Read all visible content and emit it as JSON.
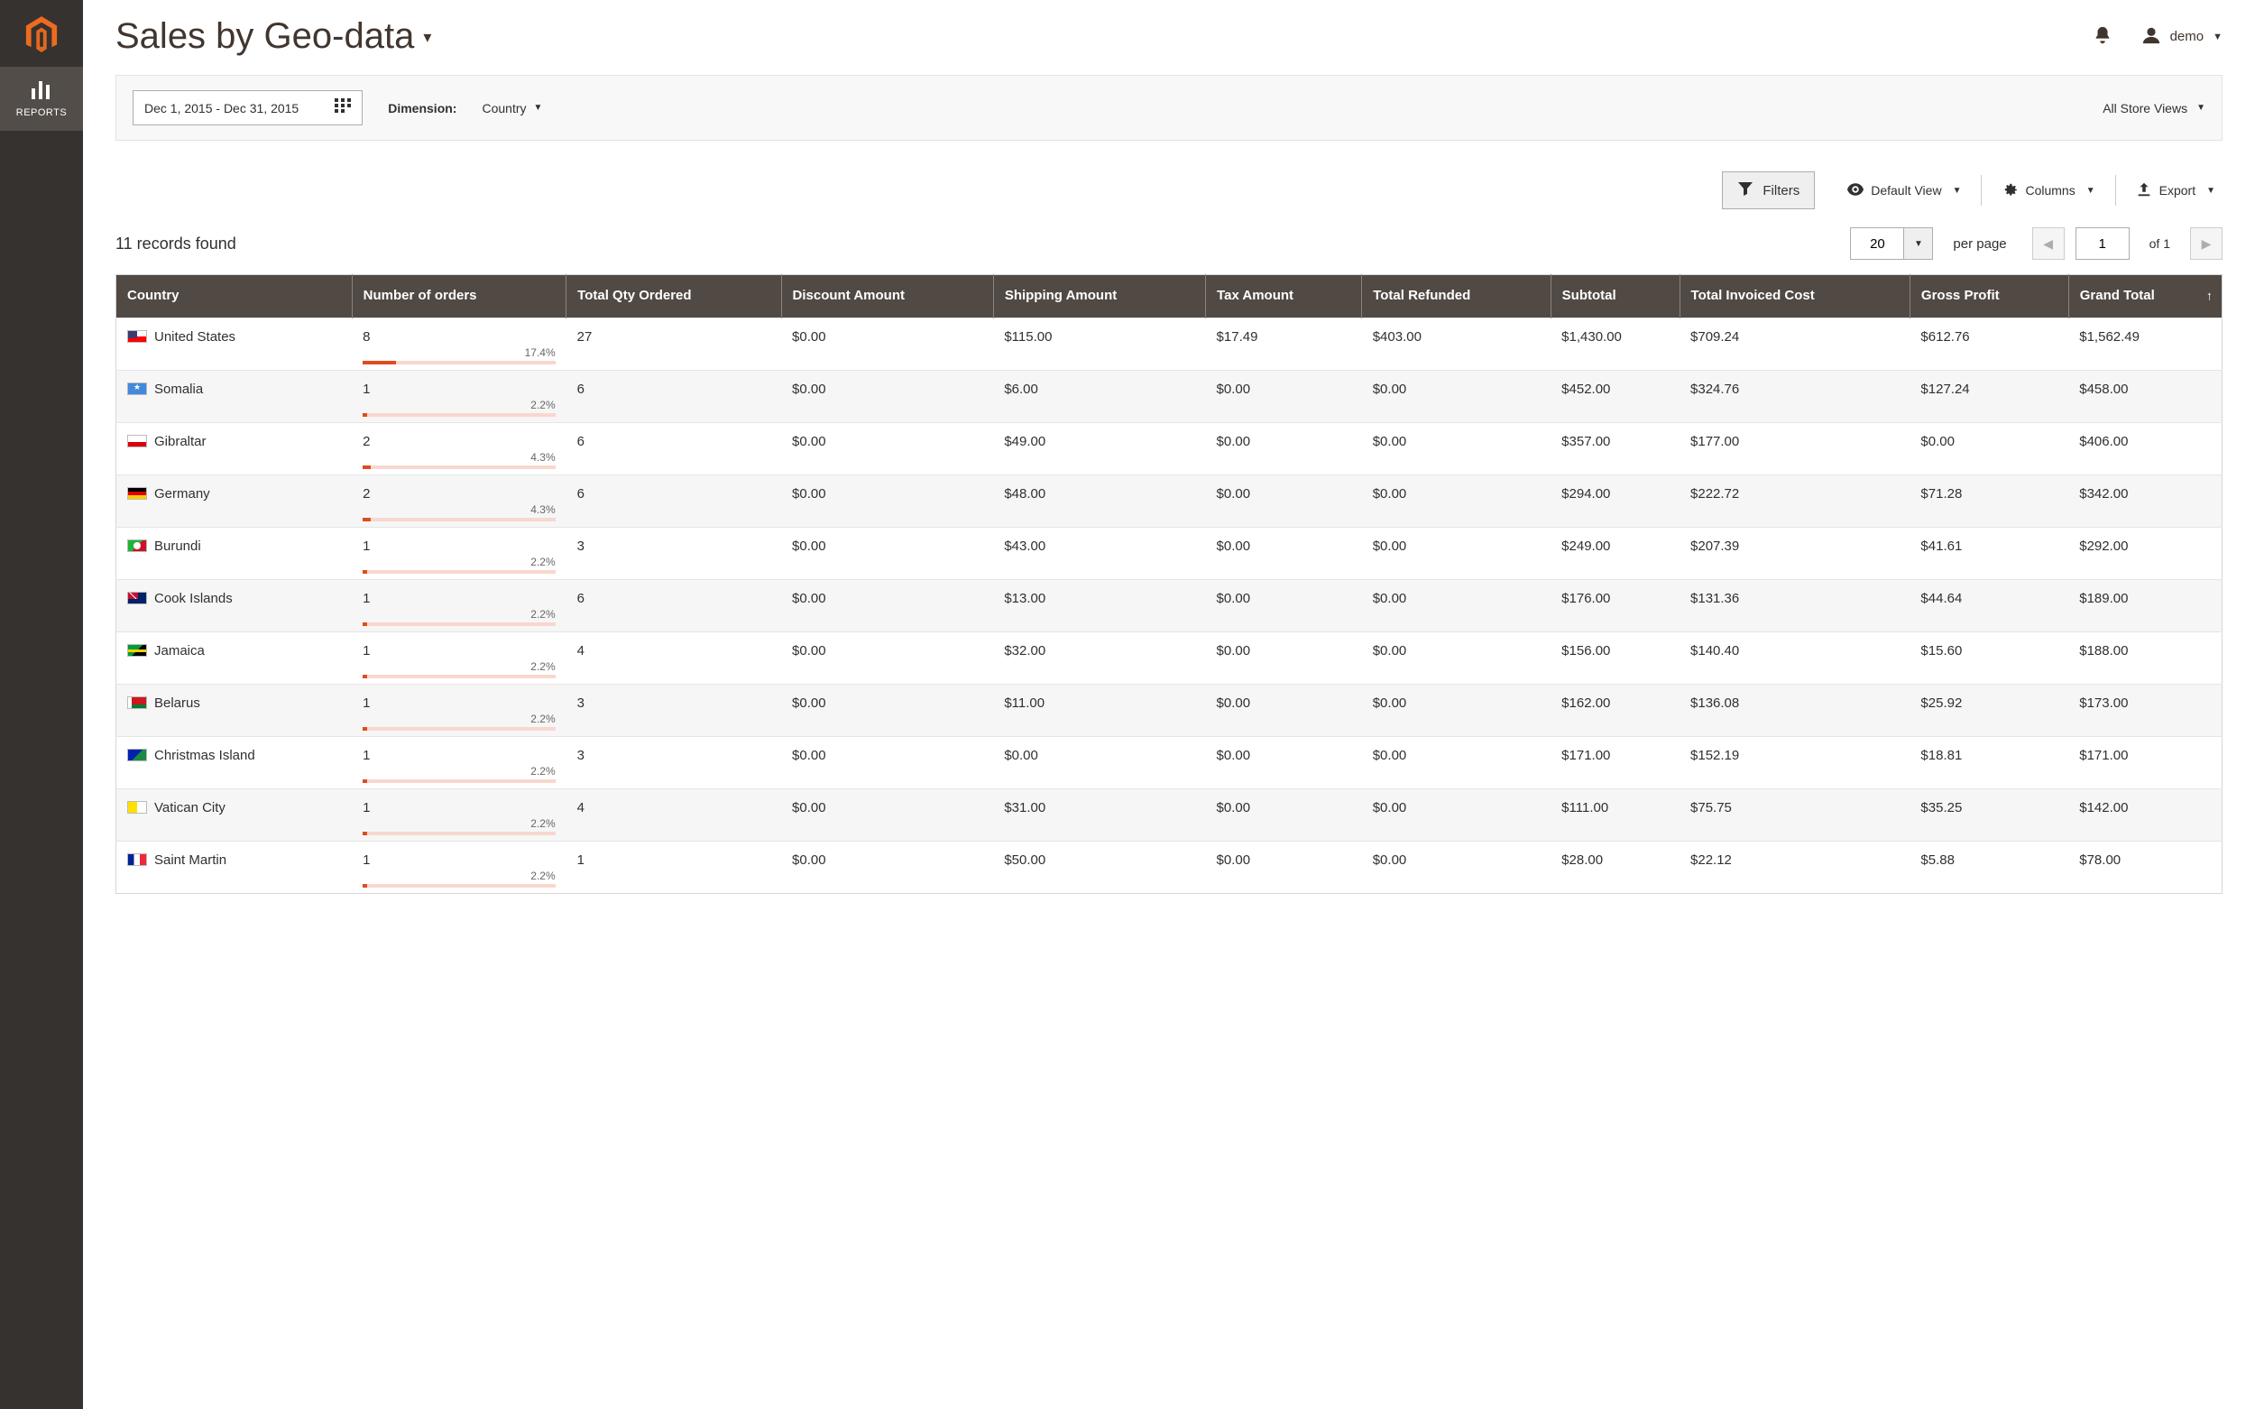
{
  "sidebar": {
    "reports_label": "REPORTS"
  },
  "header": {
    "title": "Sales by Geo-data",
    "user_name": "demo"
  },
  "toolbar": {
    "date_range": "Dec 1, 2015 - Dec 31, 2015",
    "dimension_label": "Dimension:",
    "dimension_value": "Country",
    "store_view": "All Store Views"
  },
  "actions": {
    "filters": "Filters",
    "default_view": "Default View",
    "columns": "Columns",
    "export": "Export"
  },
  "records": {
    "count_text": "11 records found",
    "per_page_value": "20",
    "per_page_label": "per page",
    "page_value": "1",
    "of_label": "of 1"
  },
  "columns": [
    "Country",
    "Number of orders",
    "Total Qty Ordered",
    "Discount Amount",
    "Shipping Amount",
    "Tax Amount",
    "Total Refunded",
    "Subtotal",
    "Total Invoiced Cost",
    "Gross Profit",
    "Grand Total"
  ],
  "rows": [
    {
      "flag": "us",
      "country": "United States",
      "orders": "8",
      "orders_pct": "17.4%",
      "bar_pct": 17.4,
      "qty": "27",
      "discount": "$0.00",
      "shipping": "$115.00",
      "tax": "$17.49",
      "refunded": "$403.00",
      "subtotal": "$1,430.00",
      "invoiced": "$709.24",
      "profit": "$612.76",
      "grand": "$1,562.49"
    },
    {
      "flag": "so",
      "country": "Somalia",
      "orders": "1",
      "orders_pct": "2.2%",
      "bar_pct": 2.2,
      "qty": "6",
      "discount": "$0.00",
      "shipping": "$6.00",
      "tax": "$0.00",
      "refunded": "$0.00",
      "subtotal": "$452.00",
      "invoiced": "$324.76",
      "profit": "$127.24",
      "grand": "$458.00"
    },
    {
      "flag": "gi",
      "country": "Gibraltar",
      "orders": "2",
      "orders_pct": "4.3%",
      "bar_pct": 4.3,
      "qty": "6",
      "discount": "$0.00",
      "shipping": "$49.00",
      "tax": "$0.00",
      "refunded": "$0.00",
      "subtotal": "$357.00",
      "invoiced": "$177.00",
      "profit": "$0.00",
      "grand": "$406.00"
    },
    {
      "flag": "de",
      "country": "Germany",
      "orders": "2",
      "orders_pct": "4.3%",
      "bar_pct": 4.3,
      "qty": "6",
      "discount": "$0.00",
      "shipping": "$48.00",
      "tax": "$0.00",
      "refunded": "$0.00",
      "subtotal": "$294.00",
      "invoiced": "$222.72",
      "profit": "$71.28",
      "grand": "$342.00"
    },
    {
      "flag": "bi",
      "country": "Burundi",
      "orders": "1",
      "orders_pct": "2.2%",
      "bar_pct": 2.2,
      "qty": "3",
      "discount": "$0.00",
      "shipping": "$43.00",
      "tax": "$0.00",
      "refunded": "$0.00",
      "subtotal": "$249.00",
      "invoiced": "$207.39",
      "profit": "$41.61",
      "grand": "$292.00"
    },
    {
      "flag": "ck",
      "country": "Cook Islands",
      "orders": "1",
      "orders_pct": "2.2%",
      "bar_pct": 2.2,
      "qty": "6",
      "discount": "$0.00",
      "shipping": "$13.00",
      "tax": "$0.00",
      "refunded": "$0.00",
      "subtotal": "$176.00",
      "invoiced": "$131.36",
      "profit": "$44.64",
      "grand": "$189.00"
    },
    {
      "flag": "jm",
      "country": "Jamaica",
      "orders": "1",
      "orders_pct": "2.2%",
      "bar_pct": 2.2,
      "qty": "4",
      "discount": "$0.00",
      "shipping": "$32.00",
      "tax": "$0.00",
      "refunded": "$0.00",
      "subtotal": "$156.00",
      "invoiced": "$140.40",
      "profit": "$15.60",
      "grand": "$188.00"
    },
    {
      "flag": "by",
      "country": "Belarus",
      "orders": "1",
      "orders_pct": "2.2%",
      "bar_pct": 2.2,
      "qty": "3",
      "discount": "$0.00",
      "shipping": "$11.00",
      "tax": "$0.00",
      "refunded": "$0.00",
      "subtotal": "$162.00",
      "invoiced": "$136.08",
      "profit": "$25.92",
      "grand": "$173.00"
    },
    {
      "flag": "cx",
      "country": "Christmas Island",
      "orders": "1",
      "orders_pct": "2.2%",
      "bar_pct": 2.2,
      "qty": "3",
      "discount": "$0.00",
      "shipping": "$0.00",
      "tax": "$0.00",
      "refunded": "$0.00",
      "subtotal": "$171.00",
      "invoiced": "$152.19",
      "profit": "$18.81",
      "grand": "$171.00"
    },
    {
      "flag": "va",
      "country": "Vatican City",
      "orders": "1",
      "orders_pct": "2.2%",
      "bar_pct": 2.2,
      "qty": "4",
      "discount": "$0.00",
      "shipping": "$31.00",
      "tax": "$0.00",
      "refunded": "$0.00",
      "subtotal": "$111.00",
      "invoiced": "$75.75",
      "profit": "$35.25",
      "grand": "$142.00"
    },
    {
      "flag": "mf",
      "country": "Saint Martin",
      "orders": "1",
      "orders_pct": "2.2%",
      "bar_pct": 2.2,
      "qty": "1",
      "discount": "$0.00",
      "shipping": "$50.00",
      "tax": "$0.00",
      "refunded": "$0.00",
      "subtotal": "$28.00",
      "invoiced": "$22.12",
      "profit": "$5.88",
      "grand": "$78.00"
    }
  ]
}
